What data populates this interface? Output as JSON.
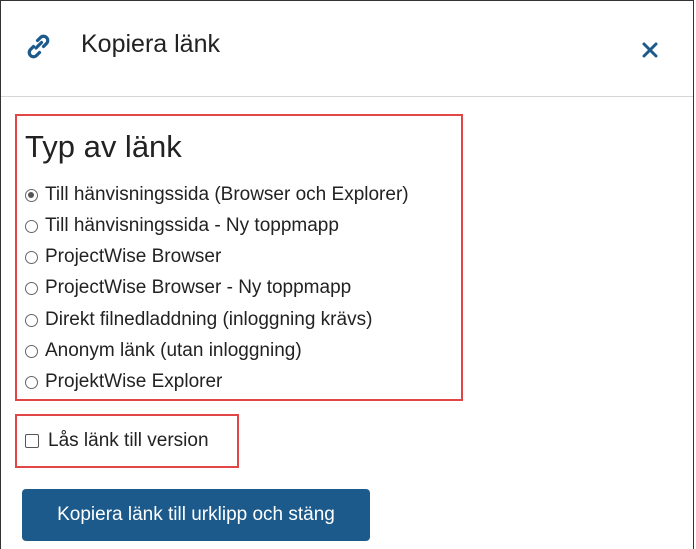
{
  "dialog": {
    "title": "Kopiera länk",
    "icon": "link-icon",
    "close_icon": "close-icon"
  },
  "link_type": {
    "heading": "Typ av länk",
    "options": [
      {
        "label": "Till hänvisningssida (Browser och Explorer)",
        "selected": true
      },
      {
        "label": "Till hänvisningssida - Ny toppmapp",
        "selected": false
      },
      {
        "label": "ProjectWise Browser",
        "selected": false
      },
      {
        "label": "ProjectWise Browser - Ny toppmapp",
        "selected": false
      },
      {
        "label": "Direkt filnedladdning (inloggning krävs)",
        "selected": false
      },
      {
        "label": "Anonym länk (utan inloggning)",
        "selected": false
      },
      {
        "label": "ProjektWise Explorer",
        "selected": false
      }
    ]
  },
  "lock_version": {
    "label": "Lås länk till version",
    "checked": false
  },
  "actions": {
    "copy_label": "Kopiera länk till urklipp och stäng"
  },
  "colors": {
    "accent": "#1c5a8c",
    "highlight_border": "#e04646",
    "link_icon": "#1c5a8c"
  }
}
